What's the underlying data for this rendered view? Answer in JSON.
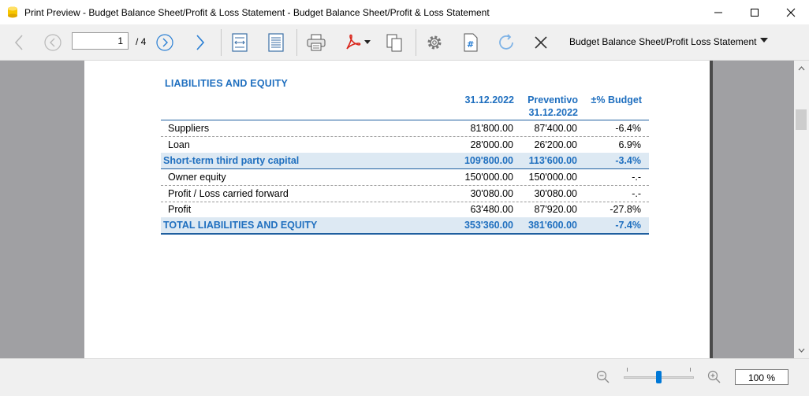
{
  "window": {
    "title": "Print Preview - Budget Balance Sheet/Profit & Loss Statement - Budget Balance Sheet/Profit & Loss Statement"
  },
  "toolbar": {
    "page_current": "1",
    "page_total": "/ 4",
    "report_name": "Budget Balance Sheet/Profit  Loss Statement"
  },
  "report": {
    "section_title": "LIABILITIES AND EQUITY",
    "col_actual_label": "31.12.2022",
    "col_budget_label_1": "Preventivo",
    "col_budget_label_2": "31.12.2022",
    "col_pct_label": "±% Budget",
    "rows": [
      {
        "label": "Suppliers",
        "actual": "81'800.00",
        "budget": "87'400.00",
        "pct": "-6.4%"
      },
      {
        "label": "Loan",
        "actual": "28'000.00",
        "budget": "26'200.00",
        "pct": "6.9%"
      },
      {
        "label": "Short-term third party capital",
        "actual": "109'800.00",
        "budget": "113'600.00",
        "pct": "-3.4%"
      },
      {
        "label": "Owner equity",
        "actual": "150'000.00",
        "budget": "150'000.00",
        "pct": "-.-"
      },
      {
        "label": "Profit / Loss carried forward",
        "actual": "30'080.00",
        "budget": "30'080.00",
        "pct": "-.-"
      },
      {
        "label": "Profit",
        "actual": "63'480.00",
        "budget": "87'920.00",
        "pct": "-27.8%"
      },
      {
        "label": "TOTAL LIABILITIES AND EQUITY",
        "actual": "353'360.00",
        "budget": "381'600.00",
        "pct": "-7.4%"
      }
    ]
  },
  "status": {
    "zoom": "100 %"
  },
  "colors": {
    "accent": "#1f6fbf",
    "total_row_bg": "#dde9f3",
    "viewport_bg": "#a0a0a3"
  }
}
